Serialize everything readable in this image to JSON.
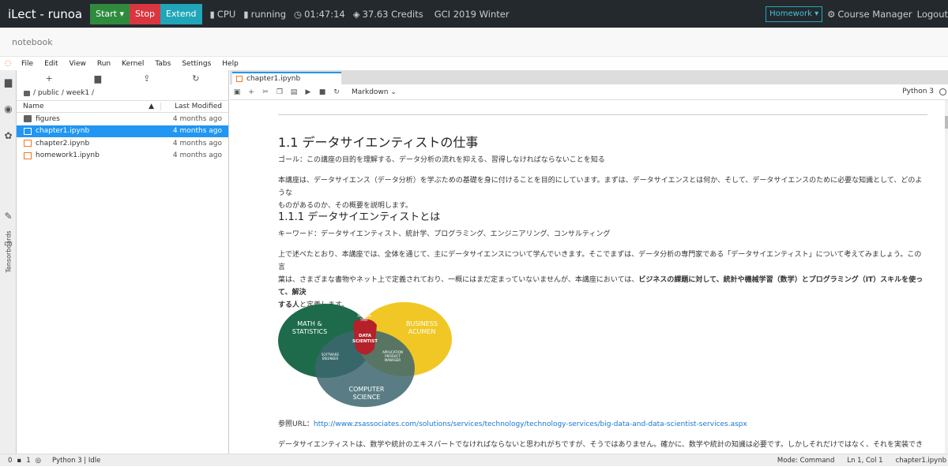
{
  "topbar": {
    "brand": "iLect - runoa",
    "start": "Start",
    "stop": "Stop",
    "extend": "Extend",
    "cpu": "CPU",
    "status": "running",
    "time": "01:47:14",
    "credits": "37.63 Credits",
    "course": "GCI 2019 Winter",
    "homework": "Homework",
    "course_manager": "Course Manager",
    "logout": "Logout"
  },
  "subbar": {
    "label": "notebook"
  },
  "menu": [
    "File",
    "Edit",
    "View",
    "Run",
    "Kernel",
    "Tabs",
    "Settings",
    "Help"
  ],
  "sidebar": {
    "tensorboards": "Tensorboards"
  },
  "filebrowser": {
    "path": "/ public / week1 /",
    "col_name": "Name",
    "col_modified": "Last Modified",
    "files": [
      {
        "name": "figures",
        "modified": "4 months ago",
        "type": "folder"
      },
      {
        "name": "chapter1.ipynb",
        "modified": "4 months ago",
        "type": "notebook"
      },
      {
        "name": "chapter2.ipynb",
        "modified": "4 months ago",
        "type": "notebook"
      },
      {
        "name": "homework1.ipynb",
        "modified": "4 months ago",
        "type": "notebook"
      }
    ]
  },
  "notebook": {
    "tab": "chapter1.ipynb",
    "cell_type": "Markdown",
    "kernel": "Python 3",
    "h1_num": "1.1",
    "h1": "データサイエンティストの仕事",
    "goal": "ゴール：この講座の目的を理解する、データ分析の流れを抑える、習得しなければならないことを知る",
    "intro_1": "本講座は、データサイエンス（データ分析）を学ぶための基礎を身に付けることを目的にしています。まずは、データサイエンスとは何か、そして、データサイエンスのために必要な知識として、どのような",
    "intro_2": "ものがあるのか、その概要を説明します。",
    "h2_num": "1.1.1",
    "h2": "データサイエンティストとは",
    "keywords": "キーワード：データサイエンティスト、統計学、プログラミング、エンジニアリング、コンサルティング",
    "body_1": "上で述べたとおり、本講座では、全体を通じて、主にデータサイエンスについて学んでいきます。そこでまずは、データ分析の専門家である「データサイエンティスト」について考えてみましょう。この言",
    "body_2a": "葉は、さまざまな書物やネット上で定義されており、一概にはまだ定まっていないませんが、本講座においては、",
    "body_2b": "ビジネスの課題に対して、統計や機械学習（数学）とプログラミング（IT）スキルを使って、解決",
    "body_3a": "する人",
    "body_3b": "と定義します。",
    "ref_label": "参照URL：",
    "ref_url": "http://www.zsassociates.com/solutions/services/technology/technology-services/big-data-and-data-scientist-services.aspx",
    "last_line": "データサイエンティストは、数学や統計のエキスパートでなければならないと思われがちですが、そうではありません。確かに、数学や統計の知識は必要です。しかしそれだけではなく、それを実装できるエ"
  },
  "venn": {
    "math_1": "MATH &",
    "math_2": "STATISTICS",
    "business_1": "BUSINESS",
    "business_2": "ACUMEN",
    "cs_1": "COMPUTER",
    "cs_2": "SCIENCE",
    "ds_1": "DATA",
    "ds_2": "SCIENTIST",
    "acc_1": "ACCOUN",
    "acc_2": "TANT",
    "se_1": "SOFTWARE",
    "se_2": "ENGINEER",
    "apm_1": "APPLICATION",
    "apm_2": "PRODUCT",
    "apm_3": "MANAGER"
  },
  "statusbar": {
    "count_1": "0",
    "count_2": "1",
    "kernel_status": "Python 3 | Idle",
    "mode": "Mode: Command",
    "position": "Ln 1, Col 1",
    "file": "chapter1.ipynb"
  }
}
